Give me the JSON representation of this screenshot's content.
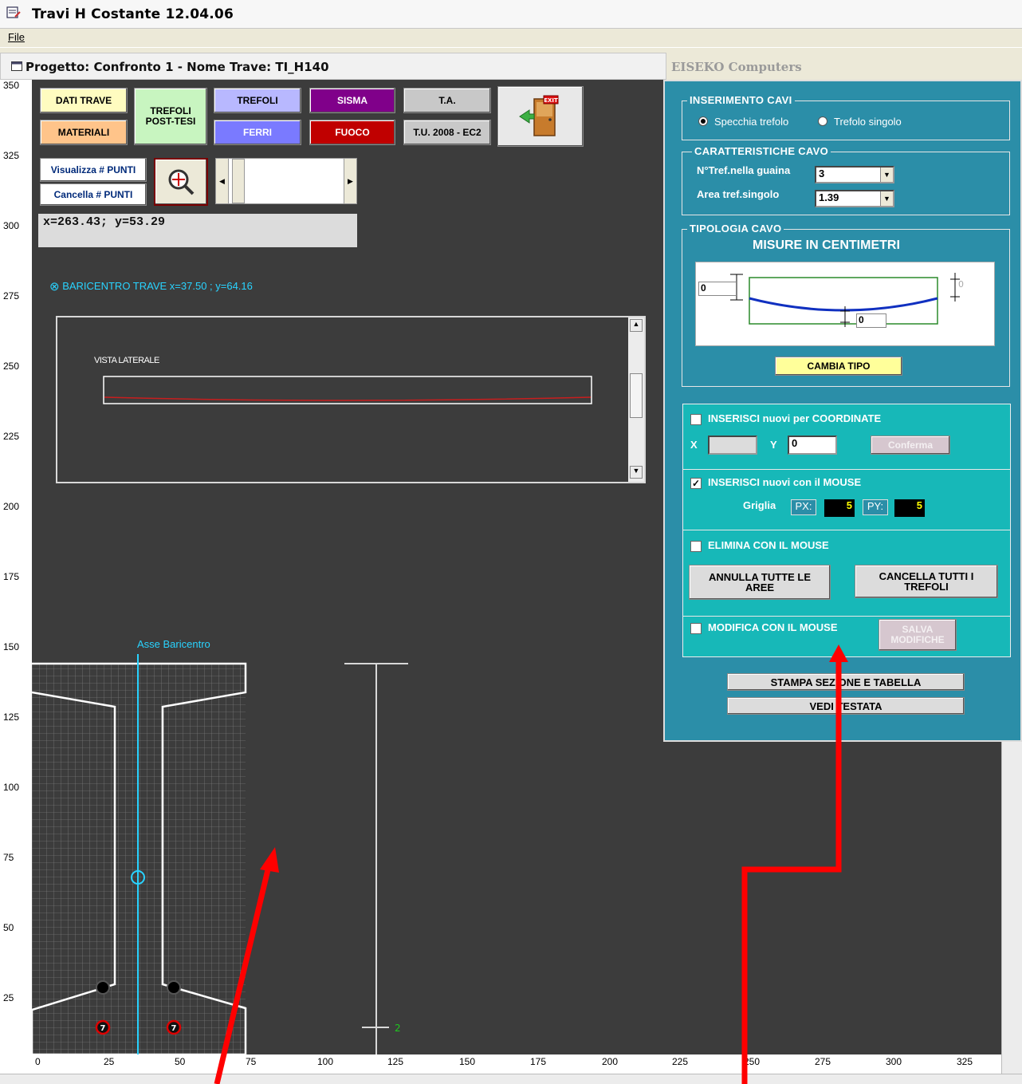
{
  "window": {
    "title": "Travi H Costante  12.04.06",
    "menu_file": "File"
  },
  "child": {
    "title": "Progetto: Confronto 1 - Nome Trave: TI_H140"
  },
  "right_panel": {
    "title": "EISEKO Computers"
  },
  "toolbar": {
    "dati_trave": "DATI TRAVE",
    "materiali": "MATERIALI",
    "trefoli_post_tesi": "TREFOLI POST-TESI",
    "trefoli": "TREFOLI",
    "ferri": "FERRI",
    "sisma": "SISMA",
    "fuoco": "FUOCO",
    "ta": "T.A.",
    "tu2008": "T.U. 2008 - EC2",
    "exit": "EXIT",
    "visualizza_punti": "Visualizza # PUNTI",
    "cancella_punti": "Cancella # PUNTI"
  },
  "coords": "x=263.43; y=53.29",
  "baricentro": "BARICENTRO TRAVE  x=37.50 ; y=64.16",
  "vista_laterale": "VISTA LATERALE",
  "asse_baricentro": "Asse Baricentro",
  "y_axis": [
    "350",
    "325",
    "300",
    "275",
    "250",
    "225",
    "200",
    "175",
    "150",
    "125",
    "100",
    "75",
    "50",
    "25",
    "0"
  ],
  "x_axis": [
    "0",
    "25",
    "50",
    "75",
    "100",
    "125",
    "150",
    "175",
    "200",
    "225",
    "250",
    "275",
    "300",
    "325"
  ],
  "tendon_labels": {
    "left": "7",
    "right": "7",
    "scale_mark": "2"
  },
  "inserimento": {
    "title": "INSERIMENTO CAVI",
    "opt_specchia": "Specchia trefolo",
    "opt_singolo": "Trefolo singolo"
  },
  "caratteristiche": {
    "title": "CARATTERISTICHE CAVO",
    "ntref_label": "N°Tref.nella guaina",
    "ntref_value": "3",
    "area_label": "Area tref.singolo",
    "area_value": "1.39"
  },
  "tipologia": {
    "title": "TIPOLOGIA CAVO",
    "subtitle": "MISURE IN CENTIMETRI",
    "left_value": "0",
    "right_value": "0",
    "mid_value": "0",
    "cambia_tipo": "CAMBIA TIPO"
  },
  "inserisci_coord": {
    "label": "INSERISCI nuovi per COORDINATE",
    "x_label": "X",
    "y_label": "Y",
    "x_value": "",
    "y_value": "0",
    "conferma": "Conferma",
    "checked": false
  },
  "inserisci_mouse": {
    "label": "INSERISCI nuovi con il MOUSE",
    "griglia": "Griglia",
    "px_label": "PX:",
    "px_value": "5",
    "py_label": "PY:",
    "py_value": "5",
    "checked": true
  },
  "elimina": {
    "label": "ELIMINA CON IL MOUSE",
    "annulla": "ANNULLA TUTTE LE AREE",
    "cancella": "CANCELLA TUTTI I TREFOLI",
    "checked": false
  },
  "modifica": {
    "label": "MODIFICA CON IL MOUSE",
    "salva": "SALVA MODIFICHE",
    "checked": false
  },
  "stampa": "STAMPA SEZIONE E TABELLA",
  "vedi_testata": "VEDI TESTATA"
}
